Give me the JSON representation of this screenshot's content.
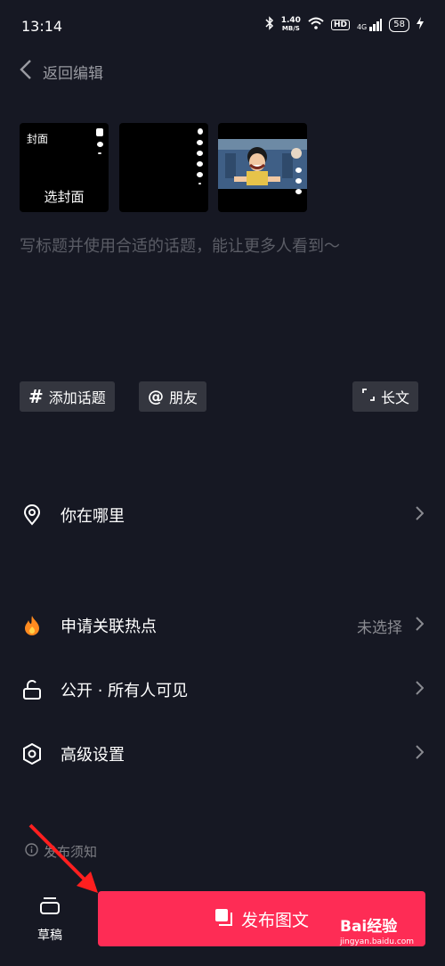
{
  "status_bar": {
    "time": "13:14",
    "net_speed": "1.40",
    "net_unit": "MB/S",
    "hd": "HD",
    "signal": "4G",
    "battery": "58"
  },
  "header": {
    "back_label": "返回编辑"
  },
  "thumbnails": {
    "cover_tag": "封面",
    "select_cover": "选封面"
  },
  "caption_placeholder": "写标题并使用合适的话题，能让更多人看到～",
  "chips": {
    "topic": "添加话题",
    "friends": "朋友",
    "long_text": "长文"
  },
  "rows": {
    "location": {
      "label": "你在哪里"
    },
    "hotspot": {
      "label": "申请关联热点",
      "value": "未选择"
    },
    "visibility": {
      "label": "公开 · 所有人可见"
    },
    "advanced": {
      "label": "高级设置"
    }
  },
  "notice": "发布须知",
  "bottom": {
    "drafts_label": "草稿",
    "publish_label": "发布图文"
  },
  "watermark": {
    "brand": "Bai经验",
    "site": "jingyan.baidu.com"
  },
  "colors": {
    "background": "#161823",
    "accent": "#fe2c55",
    "chip": "#34363f"
  }
}
